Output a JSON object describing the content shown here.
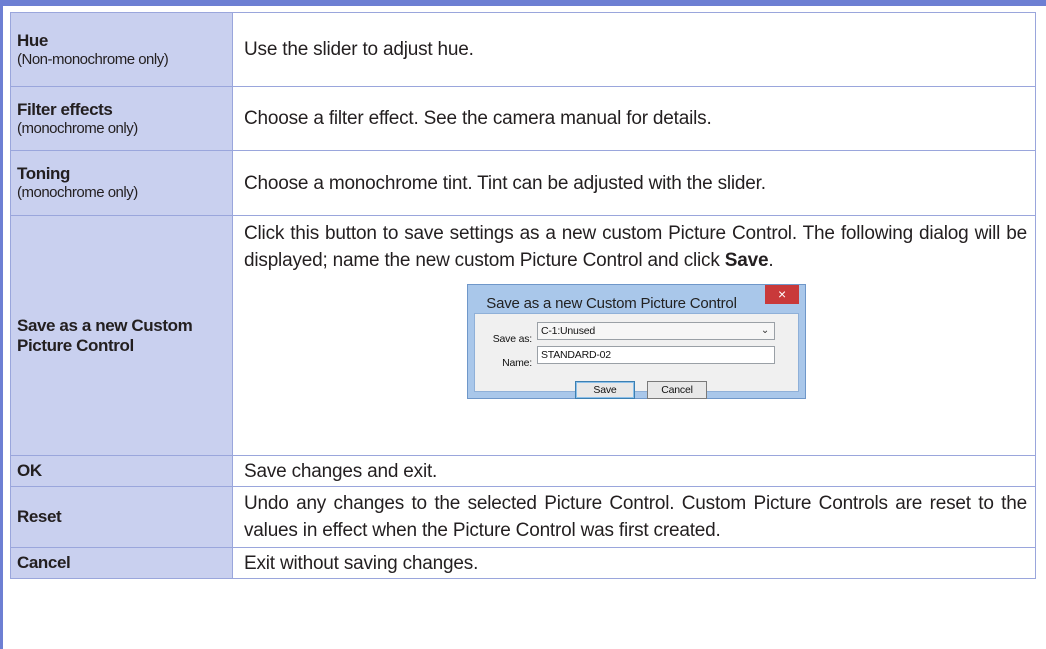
{
  "rows": [
    {
      "term": "Hue",
      "note": "(Non-monochrome only)",
      "desc": "Use the slider to adjust hue."
    },
    {
      "term": "Filter effects",
      "note": "(monochrome only)",
      "desc": "Choose a filter effect. See the camera manual for details."
    },
    {
      "term": "Toning",
      "note": "(monochrome only)",
      "desc": "Choose a monochrome tint. Tint can be adjusted with the slider."
    },
    {
      "term": "Save as a new Custom Picture Control",
      "desc_before": "Click this button to save settings as a new custom Picture Control. The following dialog will be displayed; name the new custom Picture Control and click ",
      "desc_keyword": "Save",
      "desc_after": "."
    },
    {
      "term": "OK",
      "desc": "Save changes and exit."
    },
    {
      "term": "Reset",
      "desc": "Undo any changes to the selected Picture Control. Custom Picture Controls are reset to the values in effect when the Picture Control was first created."
    },
    {
      "term": "Cancel",
      "desc": "Exit without saving changes."
    }
  ],
  "dialog": {
    "title": "Save as a new Custom Picture Control",
    "close_symbol": "×",
    "save_as_label": "Save as:",
    "save_as_value": "C-1:Unused",
    "name_label": "Name:",
    "name_value": "STANDARD-02",
    "save_button": "Save",
    "cancel_button": "Cancel",
    "caret_symbol": "⌄"
  },
  "colors": {
    "accent_bar": "#6d7fd3",
    "term_background": "#c9d0ef",
    "border": "#9aa6dc",
    "close_button": "#c9393a"
  }
}
